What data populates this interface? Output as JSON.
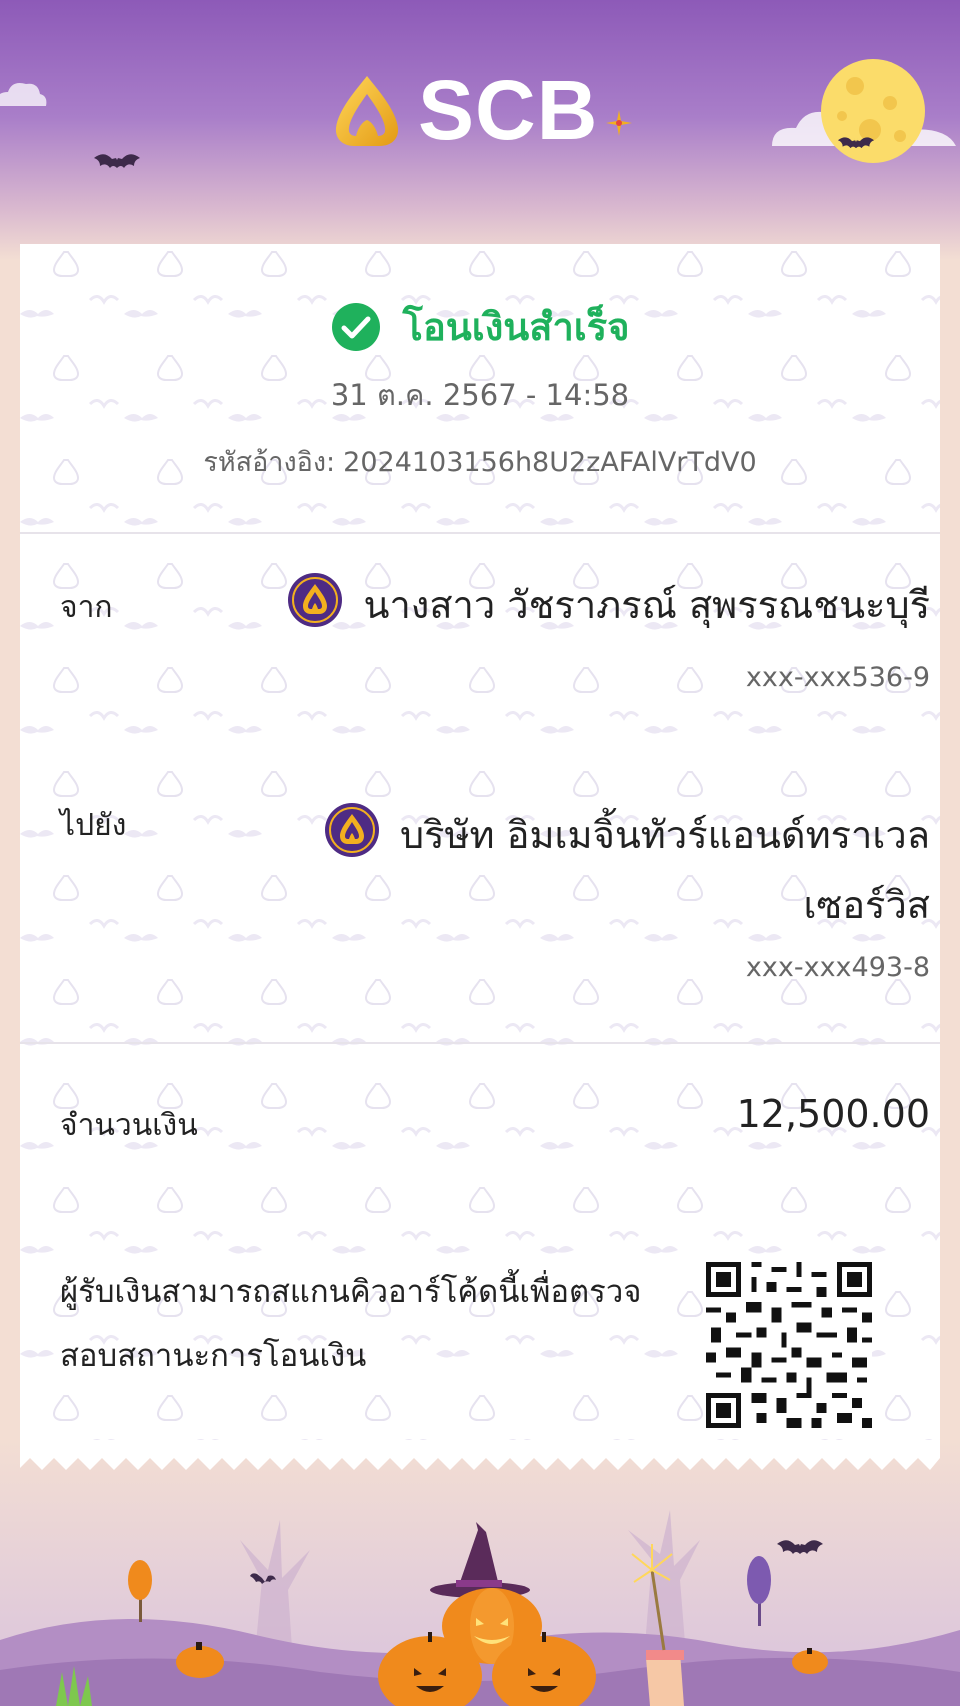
{
  "brand": {
    "name": "SCB"
  },
  "status": {
    "text": "โอนเงินสำเร็จ",
    "color": "#1fb15c",
    "icon": "check-circle-icon"
  },
  "datetime": "31 ต.ค. 2567 - 14:58",
  "reference": {
    "label": "รหัสอ้างอิง:",
    "value": "2024103156h8U2zAFAlVrTdV0"
  },
  "from": {
    "label": "จาก",
    "name": "นางสาว วัชราภรณ์ สุพรรณชนะบุรี",
    "account": "xxx-xxx536-9",
    "bank_icon": "scb-bank-icon"
  },
  "to": {
    "label": "ไปยัง",
    "name_line1": "บริษัท อิมเมจิ้นทัวร์แอนด์ทราเวล",
    "name_line2": "เซอร์วิส",
    "account": "xxx-xxx493-8",
    "bank_icon": "scb-bank-icon"
  },
  "amount": {
    "label": "จำนวนเงิน",
    "value": "12,500.00"
  },
  "qr": {
    "text": "ผู้รับเงินสามารถสแกนคิวอาร์โค้ดนี้เพื่อตรวจสอบสถานะการโอนเงิน",
    "icon": "qr-code-icon"
  },
  "theme": {
    "brand_purple": "#8d5ab8",
    "gold": "#f2b01f",
    "success_green": "#1fb15c",
    "pumpkin_orange": "#f08a1c"
  }
}
